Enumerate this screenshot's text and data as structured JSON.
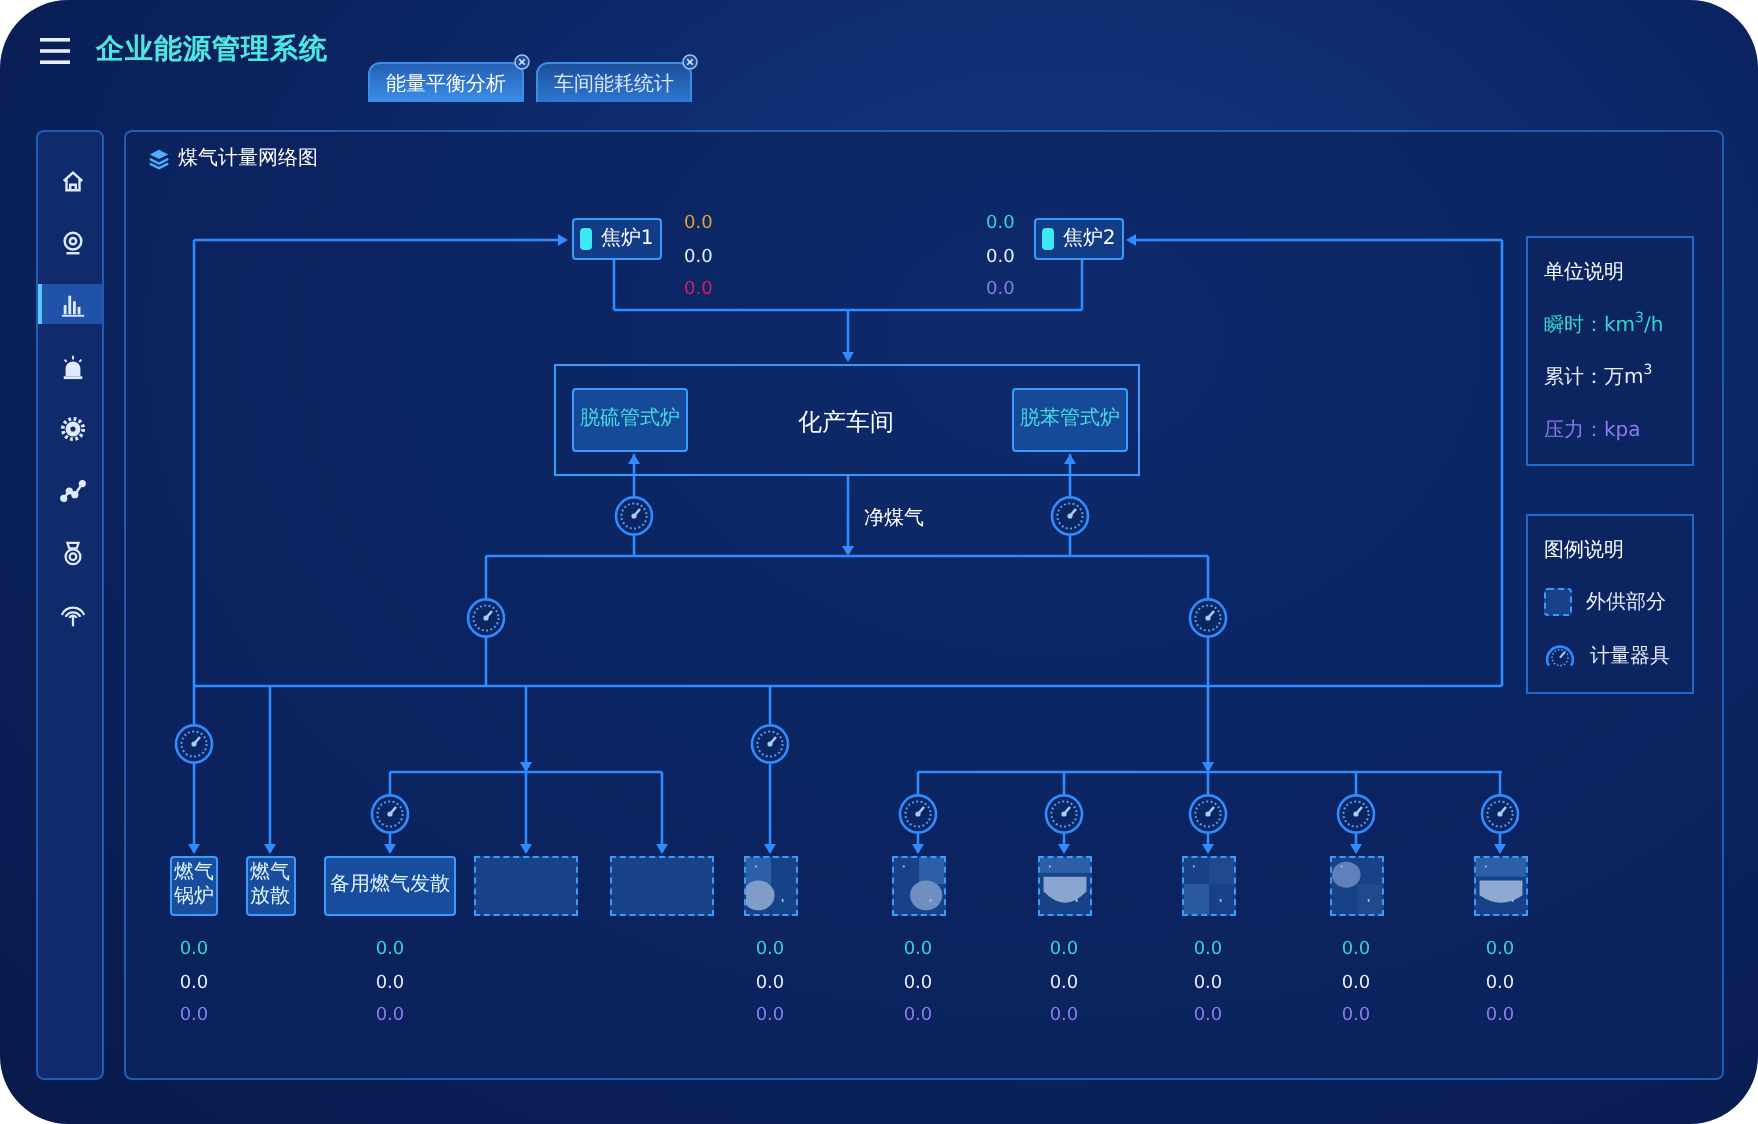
{
  "header": {
    "title": "企业能源管理系统"
  },
  "tabs": [
    {
      "label": "能量平衡分析",
      "selected": true
    },
    {
      "label": "车间能耗统计",
      "selected": false
    }
  ],
  "sidebar": {
    "items": [
      {
        "selected": false
      },
      {
        "selected": false
      },
      {
        "selected": true
      },
      {
        "selected": false
      },
      {
        "selected": false
      },
      {
        "selected": false
      },
      {
        "selected": false
      },
      {
        "selected": false
      }
    ]
  },
  "panel": {
    "title": "煤气计量网络图",
    "diagram": {
      "furnaces": [
        {
          "label": "焦炉1",
          "readings": [
            {
              "value": "0.0",
              "color": "#e0a030"
            },
            {
              "value": "0.0",
              "color": "#e8eef8"
            },
            {
              "value": "0.0",
              "color": "#d0206a"
            }
          ]
        },
        {
          "label": "焦炉2",
          "readings": [
            {
              "value": "0.0",
              "color": "#35d6d0"
            },
            {
              "value": "0.0",
              "color": "#e8eef8"
            },
            {
              "value": "0.0",
              "color": "#8a7cf0"
            }
          ]
        }
      ],
      "workshop": {
        "label": "化产车间",
        "units": [
          "脱硫管式炉",
          "脱苯管式炉"
        ]
      },
      "flow_label": "净煤气",
      "consumers": [
        {
          "label": "燃气锅炉",
          "kind": "solid",
          "metered": true,
          "readings": [
            {
              "value": "0.0",
              "color": "#35d6d0"
            },
            {
              "value": "0.0",
              "color": "#e8eef8"
            },
            {
              "value": "0.0",
              "color": "#8a7cf0"
            }
          ]
        },
        {
          "label": "燃气放散",
          "kind": "solid",
          "metered": false
        },
        {
          "label": "备用燃气发散",
          "kind": "solid",
          "metered": true,
          "readings": [
            {
              "value": "0.0",
              "color": "#35d6d0"
            },
            {
              "value": "0.0",
              "color": "#e8eef8"
            },
            {
              "value": "0.0",
              "color": "#8a7cf0"
            }
          ]
        },
        {
          "kind": "external",
          "metered": false
        },
        {
          "kind": "external",
          "metered": false
        },
        {
          "kind": "picture",
          "metered": true,
          "readings": [
            {
              "value": "0.0",
              "color": "#35d6d0"
            },
            {
              "value": "0.0",
              "color": "#e8eef8"
            },
            {
              "value": "0.0",
              "color": "#8a7cf0"
            }
          ]
        },
        {
          "kind": "picture",
          "metered": true,
          "readings": [
            {
              "value": "0.0",
              "color": "#35d6d0"
            },
            {
              "value": "0.0",
              "color": "#e8eef8"
            },
            {
              "value": "0.0",
              "color": "#8a7cf0"
            }
          ]
        },
        {
          "kind": "picture",
          "metered": true,
          "readings": [
            {
              "value": "0.0",
              "color": "#35d6d0"
            },
            {
              "value": "0.0",
              "color": "#e8eef8"
            },
            {
              "value": "0.0",
              "color": "#8a7cf0"
            }
          ]
        },
        {
          "kind": "picture",
          "metered": true,
          "readings": [
            {
              "value": "0.0",
              "color": "#35d6d0"
            },
            {
              "value": "0.0",
              "color": "#e8eef8"
            },
            {
              "value": "0.0",
              "color": "#8a7cf0"
            }
          ]
        },
        {
          "kind": "picture",
          "metered": true,
          "readings": [
            {
              "value": "0.0",
              "color": "#35d6d0"
            },
            {
              "value": "0.0",
              "color": "#e8eef8"
            },
            {
              "value": "0.0",
              "color": "#8a7cf0"
            }
          ]
        },
        {
          "kind": "picture",
          "metered": true,
          "readings": [
            {
              "value": "0.0",
              "color": "#35d6d0"
            },
            {
              "value": "0.0",
              "color": "#e8eef8"
            },
            {
              "value": "0.0",
              "color": "#8a7cf0"
            }
          ]
        }
      ]
    },
    "units_card": {
      "title": "单位说明",
      "items": [
        {
          "text": "瞬时：km$^{3}$/h",
          "color": "#35d6d0"
        },
        {
          "text": "累计：万m$^{3}$",
          "color": "#e8eef8"
        },
        {
          "text": "压力：kpa",
          "color": "#8a7cf0"
        }
      ]
    },
    "legend_card": {
      "title": "图例说明",
      "items": [
        {
          "kind": "dashed_box",
          "label": "外供部分"
        },
        {
          "kind": "gauge",
          "label": "计量器具"
        }
      ]
    }
  }
}
